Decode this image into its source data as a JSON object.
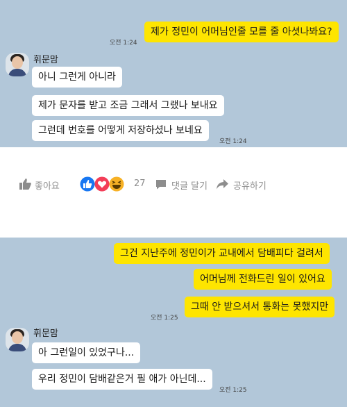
{
  "chat1": {
    "messages": [
      {
        "text": "제가 정민이 어머님인줄 모를 줄 아셧나봐요?",
        "time": "오전 1:24"
      },
      {
        "text": "아니 그런게 아니라"
      },
      {
        "text": "제가 문자를 받고 조금 그래서 그랬나 보내요"
      },
      {
        "text": "그런데 번호를 어떻게 저장하셨나 보네요",
        "time": "오전 1:24"
      }
    ],
    "sender": "휘문맘"
  },
  "facebook_bar": {
    "like_label": "좋아요",
    "reaction_count": "27",
    "comment_label": "댓글 달기",
    "share_label": "공유하기",
    "colors": {
      "like": "#1877f2",
      "love": "#f33e58",
      "haha": "#f7b125"
    }
  },
  "chat2": {
    "messages": [
      {
        "text": "그건 지난주에 정민이가 교내에서 담배피다 걸려서"
      },
      {
        "text": "어머님께 전화드린 일이 있어요"
      },
      {
        "text": "그때 안 받으셔서 통화는 못했지만",
        "time": "오전 1:25"
      },
      {
        "text": "아 그런일이 있었구나..."
      },
      {
        "text": "우리 정민이 담배같은거 필 애가 아닌데...",
        "time": "오전 1:25"
      }
    ],
    "sender": "휘문맘"
  }
}
